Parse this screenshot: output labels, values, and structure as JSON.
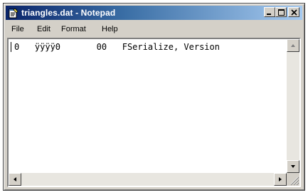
{
  "window": {
    "title": "triangles.dat - Notepad",
    "colors": {
      "titlebar_start": "#0a246a",
      "titlebar_end": "#a6caf0",
      "face": "#d4d0c8"
    }
  },
  "title_buttons": {
    "minimize_icon": "minimize-icon",
    "maximize_icon": "maximize-icon",
    "close_icon": "close-icon"
  },
  "menu": {
    "items": [
      "File",
      "Edit",
      "Format",
      "Help"
    ]
  },
  "editor": {
    "content": "0   ÿÿÿÿ0       00   FSerialize, Version"
  }
}
